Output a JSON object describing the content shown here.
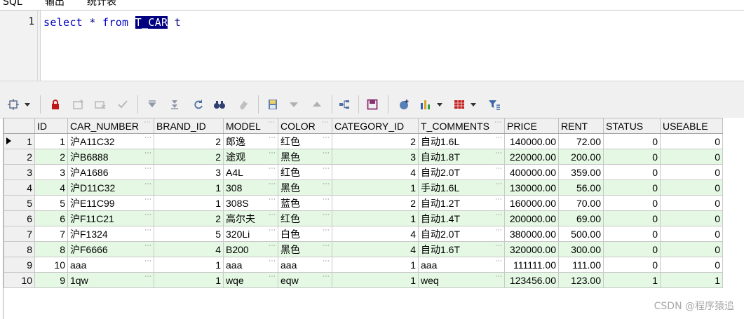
{
  "tabs": [
    "SQL",
    "输出",
    "统计表"
  ],
  "editor": {
    "line_number": "1",
    "kw_select": "select",
    "star": "*",
    "kw_from": "from",
    "table": "T_CAR",
    "alias": "t"
  },
  "toolbar": {
    "icons": [
      "grid-settings-icon",
      "lock-icon",
      "insert-row-icon",
      "delete-row-icon",
      "post-icon",
      "first-icon",
      "last-icon",
      "refresh-icon",
      "find-icon",
      "clear-icon",
      "save-grid-icon",
      "sort-down-icon",
      "sort-up-icon",
      "tree-icon",
      "floppy-icon",
      "export-icon",
      "chart-icon",
      "table-view-icon",
      "filter-icon"
    ]
  },
  "grid": {
    "columns": [
      "ID",
      "CAR_NUMBER",
      "BRAND_ID",
      "MODEL",
      "COLOR",
      "CATEGORY_ID",
      "T_COMMENTS",
      "PRICE",
      "RENT",
      "STATUS",
      "USEABLE"
    ],
    "rows": [
      {
        "n": "1",
        "ID": "1",
        "CAR_NUMBER": "沪A11C32",
        "BRAND_ID": "2",
        "MODEL": "郎逸",
        "COLOR": "红色",
        "CATEGORY_ID": "2",
        "T_COMMENTS": "自动1.6L",
        "PRICE": "140000.00",
        "RENT": "72.00",
        "STATUS": "0",
        "USEABLE": "0"
      },
      {
        "n": "2",
        "ID": "2",
        "CAR_NUMBER": "沪B6888",
        "BRAND_ID": "2",
        "MODEL": "途观",
        "COLOR": "黑色",
        "CATEGORY_ID": "3",
        "T_COMMENTS": "自动1.8T",
        "PRICE": "220000.00",
        "RENT": "200.00",
        "STATUS": "0",
        "USEABLE": "0"
      },
      {
        "n": "3",
        "ID": "3",
        "CAR_NUMBER": "沪A1686",
        "BRAND_ID": "3",
        "MODEL": "A4L",
        "COLOR": "红色",
        "CATEGORY_ID": "4",
        "T_COMMENTS": "自动2.0T",
        "PRICE": "400000.00",
        "RENT": "359.00",
        "STATUS": "0",
        "USEABLE": "0"
      },
      {
        "n": "4",
        "ID": "4",
        "CAR_NUMBER": "沪D11C32",
        "BRAND_ID": "1",
        "MODEL": "308",
        "COLOR": "黑色",
        "CATEGORY_ID": "1",
        "T_COMMENTS": "手动1.6L",
        "PRICE": "130000.00",
        "RENT": "56.00",
        "STATUS": "0",
        "USEABLE": "0"
      },
      {
        "n": "5",
        "ID": "5",
        "CAR_NUMBER": "沪E11C99",
        "BRAND_ID": "1",
        "MODEL": "308S",
        "COLOR": "蓝色",
        "CATEGORY_ID": "2",
        "T_COMMENTS": "自动1.2T",
        "PRICE": "160000.00",
        "RENT": "70.00",
        "STATUS": "0",
        "USEABLE": "0"
      },
      {
        "n": "6",
        "ID": "6",
        "CAR_NUMBER": "沪F11C21",
        "BRAND_ID": "2",
        "MODEL": "高尔夫",
        "COLOR": "红色",
        "CATEGORY_ID": "1",
        "T_COMMENTS": "自动1.4T",
        "PRICE": "200000.00",
        "RENT": "69.00",
        "STATUS": "0",
        "USEABLE": "0"
      },
      {
        "n": "7",
        "ID": "7",
        "CAR_NUMBER": "沪F1324",
        "BRAND_ID": "5",
        "MODEL": "320Li",
        "COLOR": "白色",
        "CATEGORY_ID": "4",
        "T_COMMENTS": "自动2.0T",
        "PRICE": "380000.00",
        "RENT": "500.00",
        "STATUS": "0",
        "USEABLE": "0"
      },
      {
        "n": "8",
        "ID": "8",
        "CAR_NUMBER": "沪F6666",
        "BRAND_ID": "4",
        "MODEL": "B200",
        "COLOR": "黑色",
        "CATEGORY_ID": "4",
        "T_COMMENTS": "自动1.6T",
        "PRICE": "320000.00",
        "RENT": "300.00",
        "STATUS": "0",
        "USEABLE": "0"
      },
      {
        "n": "9",
        "ID": "10",
        "CAR_NUMBER": "aaa",
        "BRAND_ID": "1",
        "MODEL": "aaa",
        "COLOR": "aaa",
        "CATEGORY_ID": "1",
        "T_COMMENTS": "aaa",
        "PRICE": "111111.00",
        "RENT": "111.00",
        "STATUS": "0",
        "USEABLE": "0"
      },
      {
        "n": "10",
        "ID": "9",
        "CAR_NUMBER": "1qw",
        "BRAND_ID": "1",
        "MODEL": "wqe",
        "COLOR": "eqw",
        "CATEGORY_ID": "1",
        "T_COMMENTS": "weq",
        "PRICE": "123456.00",
        "RENT": "123.00",
        "STATUS": "1",
        "USEABLE": "1"
      }
    ]
  },
  "watermark": "CSDN @程序猿追",
  "colors": {
    "even_row": "#e4f8e4",
    "keyword": "#0000c0",
    "selection": "#000080"
  }
}
